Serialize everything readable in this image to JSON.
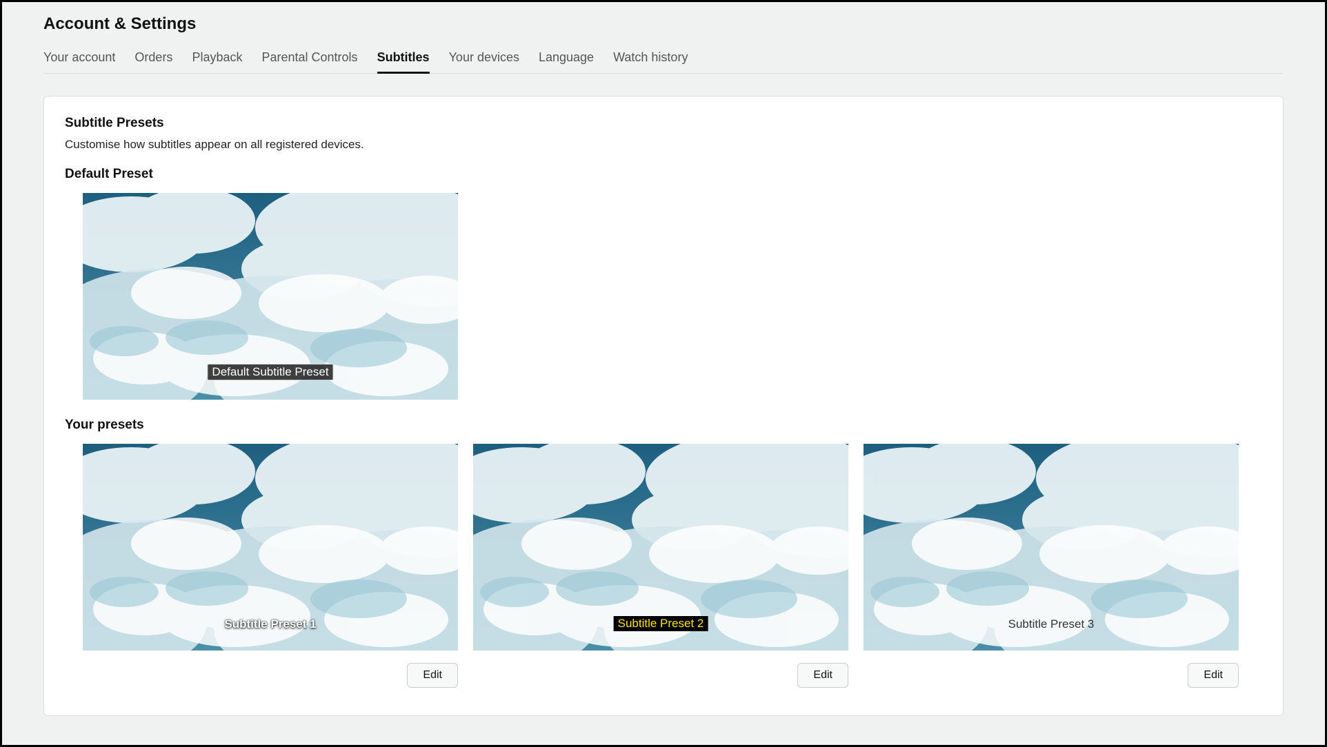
{
  "page_title": "Account & Settings",
  "tabs": {
    "your_account": "Your account",
    "orders": "Orders",
    "playback": "Playback",
    "parental_controls": "Parental Controls",
    "subtitles": "Subtitles",
    "your_devices": "Your devices",
    "language": "Language",
    "watch_history": "Watch history"
  },
  "active_tab": "subtitles",
  "subtitle_presets": {
    "heading": "Subtitle Presets",
    "description": "Customise how subtitles appear on all registered devices.",
    "default_heading": "Default Preset",
    "default_label": "Default Subtitle Preset",
    "your_presets_heading": "Your presets",
    "presets": [
      {
        "label": "Subtitle Preset 1",
        "edit": "Edit"
      },
      {
        "label": "Subtitle Preset 2",
        "edit": "Edit"
      },
      {
        "label": "Subtitle Preset 3",
        "edit": "Edit"
      }
    ]
  }
}
